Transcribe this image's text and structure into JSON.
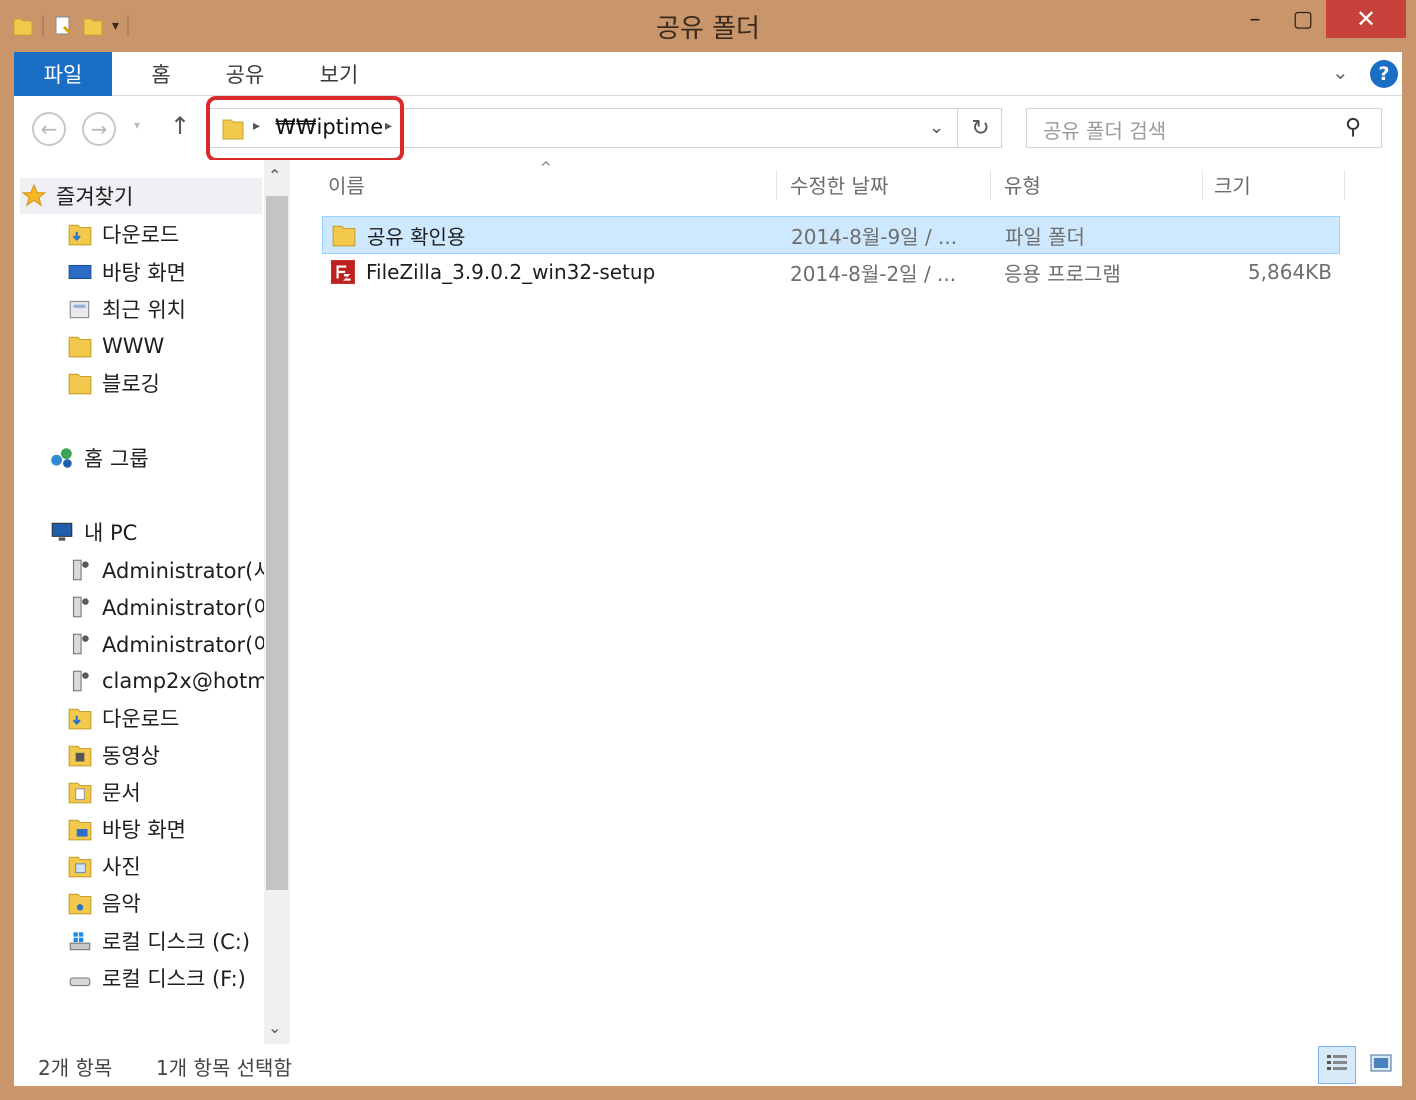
{
  "window": {
    "title": "공유 폴더",
    "minimize_glyph": "–",
    "maximize_glyph": "▢",
    "close_glyph": "✕",
    "close_color": "#c7423a",
    "frame_color": "#c9956a"
  },
  "ribbon": {
    "tabs": [
      {
        "label": "파일"
      },
      {
        "label": "홈"
      },
      {
        "label": "공유"
      },
      {
        "label": "보기"
      }
    ],
    "file_tab_color": "#1a6fc4",
    "expand_glyph": "⌄",
    "help_glyph": "?"
  },
  "address": {
    "path": "₩₩iptime",
    "search_placeholder": "공유 폴더 검색",
    "icons": {
      "back": "arrow-left-icon",
      "forward": "arrow-right-icon",
      "up": "arrow-up-icon",
      "refresh": "refresh-icon",
      "search": "search-icon"
    }
  },
  "nav": {
    "favorites": {
      "label": "즐겨찾기",
      "items": [
        {
          "label": "다운로드"
        },
        {
          "label": "바탕 화면"
        },
        {
          "label": "최근 위치"
        },
        {
          "label": "WWW"
        },
        {
          "label": "블로깅"
        }
      ]
    },
    "homegroup": {
      "label": "홈 그룹"
    },
    "pc": {
      "label": "내 PC",
      "items": [
        {
          "label": "Administrator(서"
        },
        {
          "label": "Administrator(이"
        },
        {
          "label": "Administrator(이"
        },
        {
          "label": "clamp2x@hotm"
        },
        {
          "label": "다운로드"
        },
        {
          "label": "동영상"
        },
        {
          "label": "문서"
        },
        {
          "label": "바탕 화면"
        },
        {
          "label": "사진"
        },
        {
          "label": "음악"
        },
        {
          "label": "로컬 디스크 (C:)"
        },
        {
          "label": "로컬 디스크 (F:)"
        }
      ]
    }
  },
  "list": {
    "columns": {
      "name": "이름",
      "date": "수정한 날짜",
      "type": "유형",
      "size": "크기"
    },
    "rows": [
      {
        "name": "공유 확인용",
        "date": "2014-8월-9일 / ...",
        "type": "파일 폴더",
        "size": "",
        "icon": "folder-icon",
        "selected": true
      },
      {
        "name": "FileZilla_3.9.0.2_win32-setup",
        "date": "2014-8월-2일 / ...",
        "type": "응용 프로그램",
        "size": "5,864KB",
        "icon": "filezilla-icon",
        "selected": false
      }
    ]
  },
  "status": {
    "count": "2개 항목",
    "selected": "1개 항목 선택함"
  },
  "colors": {
    "selection_bg": "#cde8ff",
    "selection_border": "#99d1ff",
    "highlight_box": "#d9292a"
  }
}
